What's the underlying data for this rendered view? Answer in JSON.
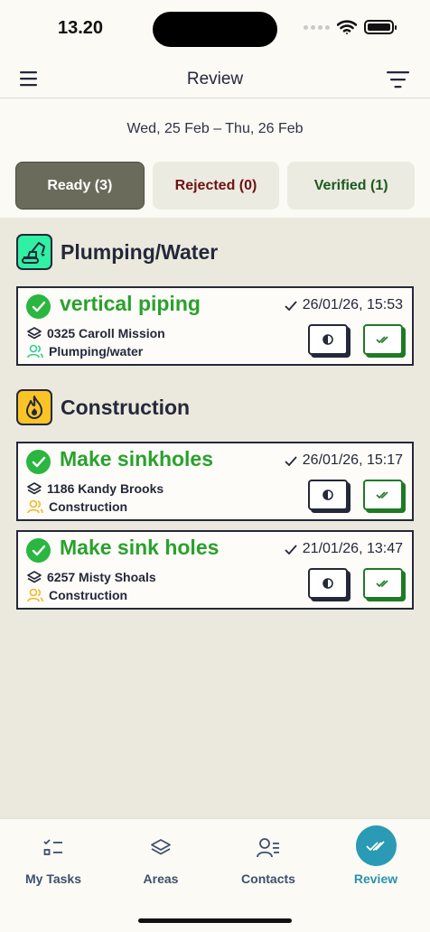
{
  "status_bar": {
    "time": "13.20"
  },
  "header": {
    "title": "Review"
  },
  "date_range": "Wed, 25 Feb – Thu, 26 Feb",
  "tabs": [
    {
      "label": "Ready (3)"
    },
    {
      "label": "Rejected (0)"
    },
    {
      "label": "Verified (1)"
    }
  ],
  "sections": [
    {
      "title": "Plumping/Water",
      "icon": "excavator-icon",
      "icon_color": "#2ff0a3",
      "cards": [
        {
          "title": "vertical piping",
          "date": "26/01/26, 15:53",
          "location": "0325 Caroll Mission",
          "assignee": "Plumping/water",
          "assignee_color": "#2ecf8f"
        }
      ]
    },
    {
      "title": "Construction",
      "icon": "fire-icon",
      "icon_color": "#fbc425",
      "cards": [
        {
          "title": "Make sinkholes",
          "date": "26/01/26, 15:17",
          "location": "1186 Kandy Brooks",
          "assignee": "Construction",
          "assignee_color": "#f2b62a"
        },
        {
          "title": "Make sink holes",
          "date": "21/01/26, 13:47",
          "location": "6257 Misty Shoals",
          "assignee": "Construction",
          "assignee_color": "#f2b62a"
        }
      ]
    }
  ],
  "bottom_nav": [
    {
      "label": "My Tasks",
      "icon": "checklist-icon"
    },
    {
      "label": "Areas",
      "icon": "layers-icon"
    },
    {
      "label": "Contacts",
      "icon": "contacts-icon"
    },
    {
      "label": "Review",
      "icon": "double-check-icon",
      "active": true
    }
  ],
  "colors": {
    "accent": "#2a9ab5",
    "success": "#2aa12e",
    "tab_active": "#6b6b5b"
  }
}
